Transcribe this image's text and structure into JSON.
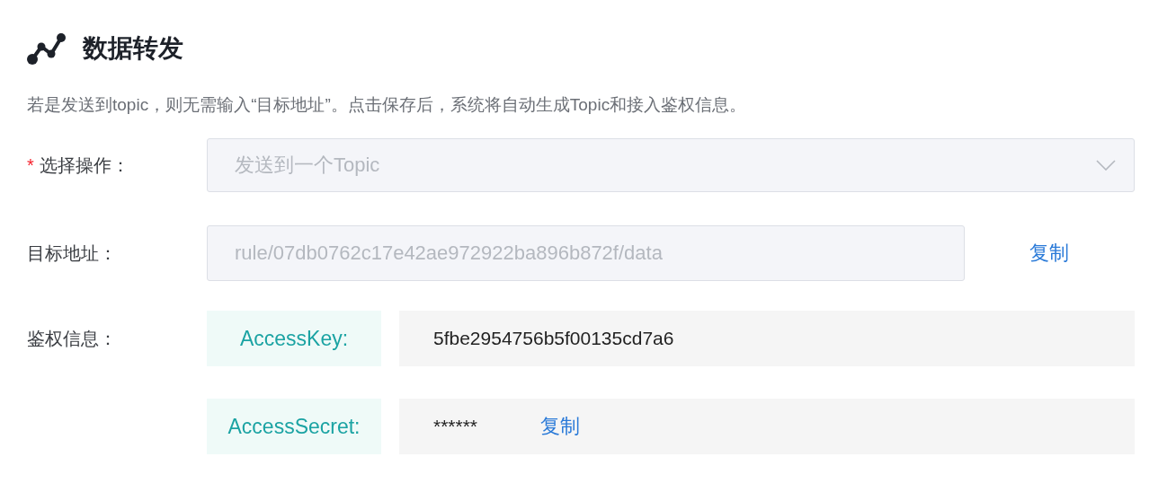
{
  "title": "数据转发",
  "description": "若是发送到topic，则无需输入“目标地址”。点击保存后，系统将自动生成Topic和接入鉴权信息。",
  "operation": {
    "label": "选择操作：",
    "required": true,
    "required_mark": "*",
    "value": "发送到一个Topic",
    "disabled": true
  },
  "target": {
    "label": "目标地址：",
    "value": "rule/07db0762c17e42ae972922ba896b872f/data",
    "disabled": true,
    "copy": "复制"
  },
  "auth": {
    "label": "鉴权信息：",
    "rows": [
      {
        "key": "AccessKey:",
        "value": "5fbe2954756b5f00135cd7a6"
      },
      {
        "key": "AccessSecret:",
        "value": "******",
        "copy": "复制"
      }
    ]
  }
}
